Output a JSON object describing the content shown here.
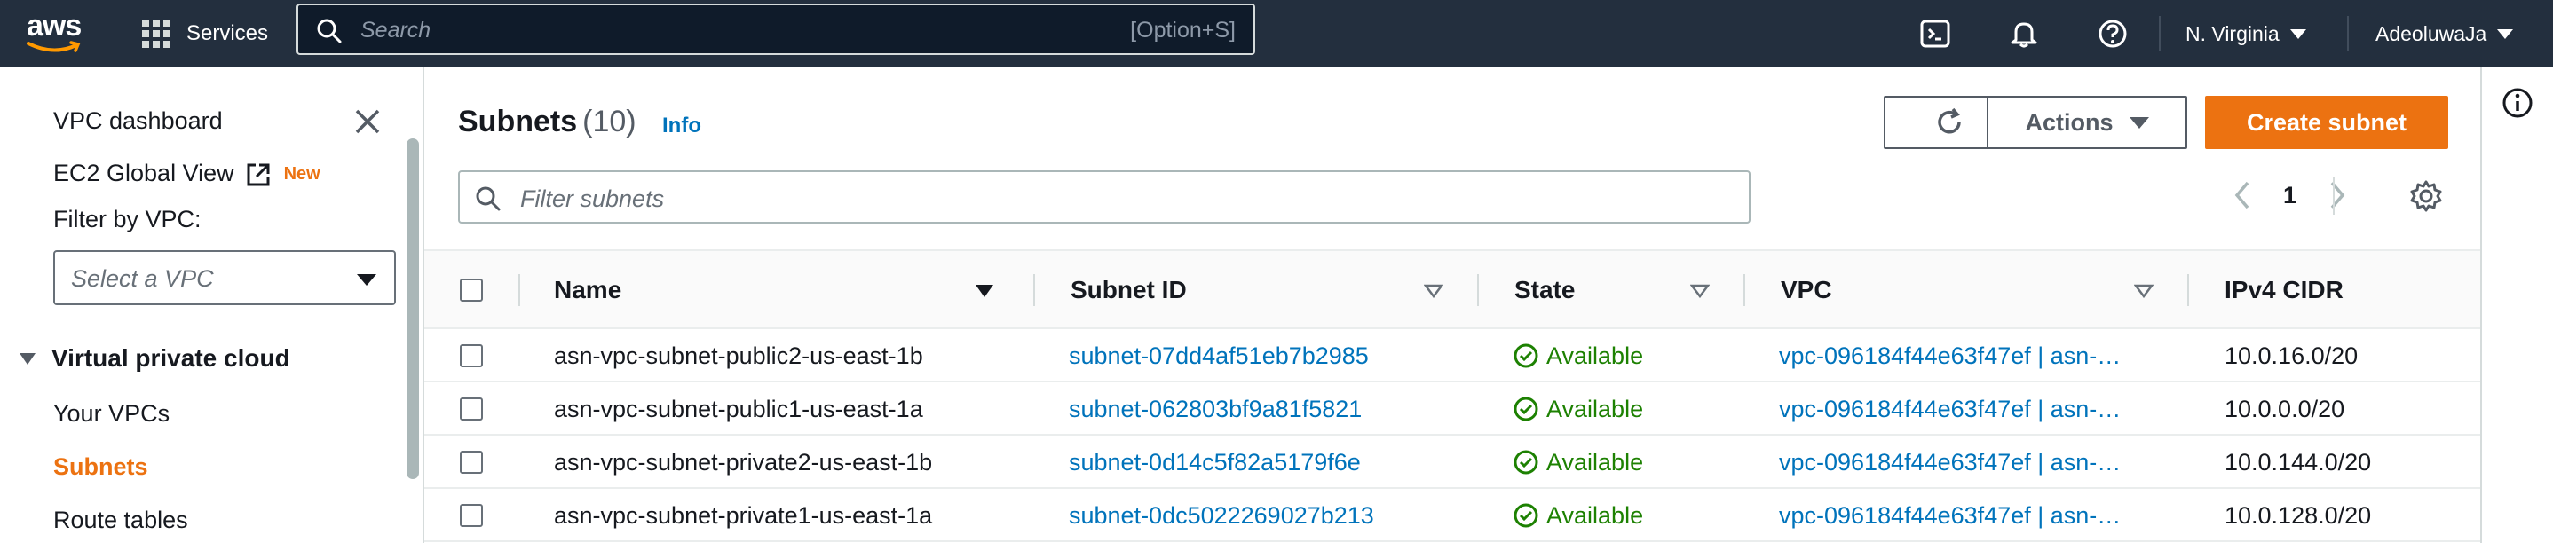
{
  "nav": {
    "logo_text": "aws",
    "services_label": "Services",
    "search_placeholder": "Search",
    "search_shortcut": "[Option+S]",
    "region_label": "N. Virginia",
    "account_label": "AdeoluwaJa"
  },
  "sidebar": {
    "dashboard_label": "VPC dashboard",
    "ec2_global_label": "EC2 Global View",
    "new_badge": "New",
    "filter_label": "Filter by VPC:",
    "vpc_select_placeholder": "Select a VPC",
    "section_label": "Virtual private cloud",
    "items": [
      {
        "label": "Your VPCs",
        "active": false
      },
      {
        "label": "Subnets",
        "active": true
      },
      {
        "label": "Route tables",
        "active": false
      }
    ]
  },
  "main": {
    "title": "Subnets",
    "count": "(10)",
    "info_label": "Info",
    "actions_label": "Actions",
    "create_label": "Create subnet",
    "filter_placeholder": "Filter subnets",
    "page_number": "1",
    "columns": [
      "Name",
      "Subnet ID",
      "State",
      "VPC",
      "IPv4 CIDR"
    ],
    "rows": [
      {
        "name": "asn-vpc-subnet-public2-us-east-1b",
        "subnet_id": "subnet-07dd4af51eb7b2985",
        "state": "Available",
        "vpc": "vpc-096184f44e63f47ef | asn-…",
        "cidr": "10.0.16.0/20"
      },
      {
        "name": "asn-vpc-subnet-public1-us-east-1a",
        "subnet_id": "subnet-062803bf9a81f5821",
        "state": "Available",
        "vpc": "vpc-096184f44e63f47ef | asn-…",
        "cidr": "10.0.0.0/20"
      },
      {
        "name": "asn-vpc-subnet-private2-us-east-1b",
        "subnet_id": "subnet-0d14c5f82a5179f6e",
        "state": "Available",
        "vpc": "vpc-096184f44e63f47ef | asn-…",
        "cidr": "10.0.144.0/20"
      },
      {
        "name": "asn-vpc-subnet-private1-us-east-1a",
        "subnet_id": "subnet-0dc5022269027b213",
        "state": "Available",
        "vpc": "vpc-096184f44e63f47ef | asn-…",
        "cidr": "10.0.128.0/20"
      }
    ]
  },
  "colors": {
    "nav_bg": "#232f3e",
    "accent_orange": "#ec7211",
    "link_blue": "#0073bb",
    "status_green": "#1d8102"
  },
  "icons": [
    "grid-icon",
    "search-icon",
    "cloudshell-icon",
    "bell-icon",
    "help-icon",
    "close-icon",
    "external-link-icon",
    "refresh-icon",
    "chevron-left-icon",
    "chevron-right-icon",
    "gear-icon",
    "sort-icon",
    "check-circle-icon",
    "info-circle-icon"
  ]
}
